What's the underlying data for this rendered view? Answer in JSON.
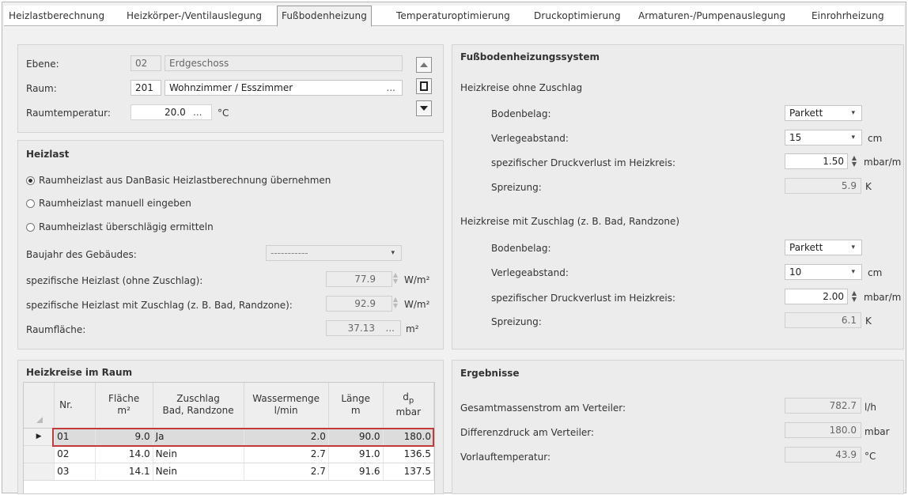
{
  "tabs": [
    "Heizlastberechnung",
    "Heizkörper-/Ventilauslegung",
    "Fußbodenheizung",
    "Temperaturoptimierung",
    "Druckoptimierung",
    "Armaturen-/Pumpenauslegung",
    "Einrohrheizung"
  ],
  "room": {
    "ebene_label": "Ebene:",
    "ebene_nr": "02",
    "ebene_name": "Erdgeschoss",
    "raum_label": "Raum:",
    "raum_nr": "201",
    "raum_name": "Wohnzimmer / Esszimmer",
    "dots": "...",
    "temp_label": "Raumtemperatur:",
    "temp_value": "20.0",
    "temp_unit": "°C"
  },
  "heizlast": {
    "title": "Heizlast",
    "options": [
      "Raumheizlast aus DanBasic Heizlastberechnung übernehmen",
      "Raumheizlast manuell eingeben",
      "Raumheizlast überschlägig ermitteln"
    ],
    "selected": 0,
    "baujahr_label": "Baujahr des Gebäudes:",
    "baujahr_value": "-----------",
    "spez_label": "spezifische Heizlast (ohne Zuschlag):",
    "spez_value": "77.9",
    "spez_unit": "W/m²",
    "spezz_label": "spezifische Heizlast mit Zuschlag (z. B. Bad, Randzone):",
    "spezz_value": "92.9",
    "spezz_unit": "W/m²",
    "flaeche_label": "Raumfläche:",
    "flaeche_value": "37.13",
    "flaeche_unit": "m²"
  },
  "system": {
    "title": "Fußbodenheizungssystem",
    "group1": {
      "title": "Heizkreise ohne Zuschlag",
      "belag_label": "Bodenbelag:",
      "belag_value": "Parkett",
      "abstand_label": "Verlegeabstand:",
      "abstand_value": "15",
      "abstand_unit": "cm",
      "druck_label": "spezifischer Druckverlust im Heizkreis:",
      "druck_value": "1.50",
      "druck_unit": "mbar/m",
      "spreizung_label": "Spreizung:",
      "spreizung_value": "5.9",
      "spreizung_unit": "K"
    },
    "group2": {
      "title": "Heizkreise mit Zuschlag (z. B. Bad, Randzone)",
      "belag_label": "Bodenbelag:",
      "belag_value": "Parkett",
      "abstand_label": "Verlegeabstand:",
      "abstand_value": "10",
      "abstand_unit": "cm",
      "druck_label": "spezifischer Druckverlust im Heizkreis:",
      "druck_value": "2.00",
      "druck_unit": "mbar/m",
      "spreizung_label": "Spreizung:",
      "spreizung_value": "6.1",
      "spreizung_unit": "K"
    }
  },
  "kreise": {
    "title": "Heizkreise im Raum",
    "headers": {
      "nr": "Nr.",
      "flaeche": "Fläche",
      "flaeche_unit": "m²",
      "zuschlag": "Zuschlag",
      "zuschlag2": "Bad, Randzone",
      "wasser": "Wassermenge",
      "wasser_unit": "l/min",
      "laenge": "Länge",
      "laenge_unit": "m",
      "dp": "d",
      "dp_sub": "p",
      "dp_unit": "mbar"
    },
    "rows": [
      {
        "nr": "01",
        "flaeche": "9.0",
        "zuschlag": "Ja",
        "wasser": "2.0",
        "laenge": "90.0",
        "dp": "180.0"
      },
      {
        "nr": "02",
        "flaeche": "14.0",
        "zuschlag": "Nein",
        "wasser": "2.7",
        "laenge": "91.0",
        "dp": "136.5"
      },
      {
        "nr": "03",
        "flaeche": "14.1",
        "zuschlag": "Nein",
        "wasser": "2.7",
        "laenge": "91.6",
        "dp": "137.5"
      }
    ]
  },
  "ergebnisse": {
    "title": "Ergebnisse",
    "massen_label": "Gesamtmassenstrom am Verteiler:",
    "massen_value": "782.7",
    "massen_unit": "l/h",
    "diff_label": "Differenzdruck am Verteiler:",
    "diff_value": "180.0",
    "diff_unit": "mbar",
    "vorlauf_label": "Vorlauftemperatur:",
    "vorlauf_value": "43.9",
    "vorlauf_unit": "°C"
  }
}
